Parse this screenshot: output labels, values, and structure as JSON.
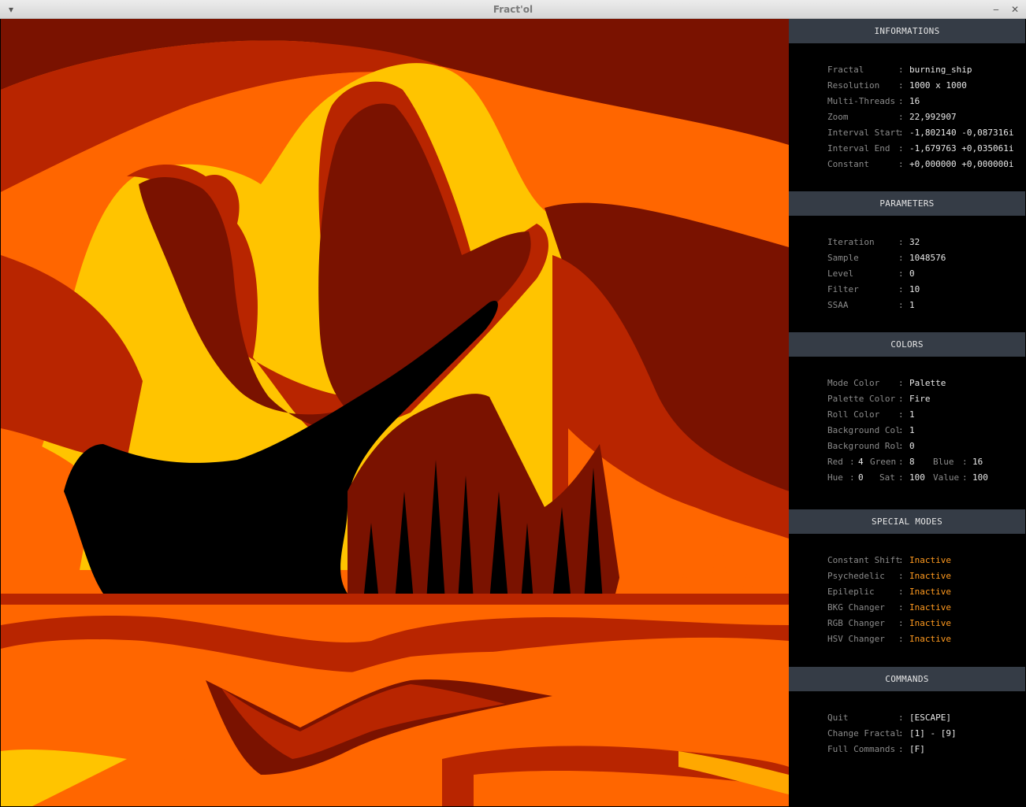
{
  "window": {
    "title": "Fract'ol"
  },
  "colors": {
    "header_bg": "#353c46",
    "inactive": "#ff9a1f",
    "palette": [
      "#000000",
      "#7a1200",
      "#b82500",
      "#ff6600",
      "#ffa800",
      "#ffc400"
    ]
  },
  "informations": {
    "header": "INFORMATIONS",
    "rows": [
      {
        "label": "Fractal",
        "value": "burning_ship"
      },
      {
        "label": "Resolution",
        "value": "1000 x 1000"
      },
      {
        "label": "Multi-Threads",
        "value": "16"
      },
      {
        "label": "Zoom",
        "value": "22,992907"
      },
      {
        "label": "Interval Start",
        "value": "-1,802140 -0,087316i"
      },
      {
        "label": "Interval End",
        "value": "-1,679763 +0,035061i"
      },
      {
        "label": "Constant",
        "value": "+0,000000 +0,000000i"
      }
    ]
  },
  "parameters": {
    "header": "PARAMETERS",
    "rows": [
      {
        "label": "Iteration",
        "value": "32"
      },
      {
        "label": "Sample",
        "value": "1048576"
      },
      {
        "label": "Level",
        "value": "0"
      },
      {
        "label": "Filter",
        "value": "10"
      },
      {
        "label": "SSAA",
        "value": "1"
      }
    ]
  },
  "colors_section": {
    "header": "COLORS",
    "rows": [
      {
        "label": "Mode Color",
        "value": "Palette"
      },
      {
        "label": "Palette Color",
        "value": "Fire"
      },
      {
        "label": "Roll Color",
        "value": "1"
      },
      {
        "label": "Background Col",
        "value": "1"
      },
      {
        "label": "Background Rol",
        "value": "0"
      }
    ],
    "rgb": {
      "red_label": "Red",
      "red": "4",
      "green_label": "Green",
      "green": "8",
      "blue_label": "Blue",
      "blue": "16"
    },
    "hsv": {
      "hue_label": "Hue",
      "hue": "0",
      "sat_label": "Sat",
      "sat": "100",
      "value_label": "Value",
      "value": "100"
    }
  },
  "special_modes": {
    "header": "SPECIAL MODES",
    "rows": [
      {
        "label": "Constant Shift",
        "value": "Inactive"
      },
      {
        "label": "Psychedelic",
        "value": "Inactive"
      },
      {
        "label": "Epileplic",
        "value": "Inactive"
      },
      {
        "label": "BKG Changer",
        "value": "Inactive"
      },
      {
        "label": "RGB Changer",
        "value": "Inactive"
      },
      {
        "label": "HSV Changer",
        "value": "Inactive"
      }
    ]
  },
  "commands": {
    "header": "COMMANDS",
    "rows": [
      {
        "label": "Quit",
        "value": "[ESCAPE]"
      },
      {
        "label": "Change Fractal",
        "value": "[1] - [9]"
      },
      {
        "label": "Full Commands",
        "value": "[F]"
      }
    ]
  },
  "separator": ":"
}
